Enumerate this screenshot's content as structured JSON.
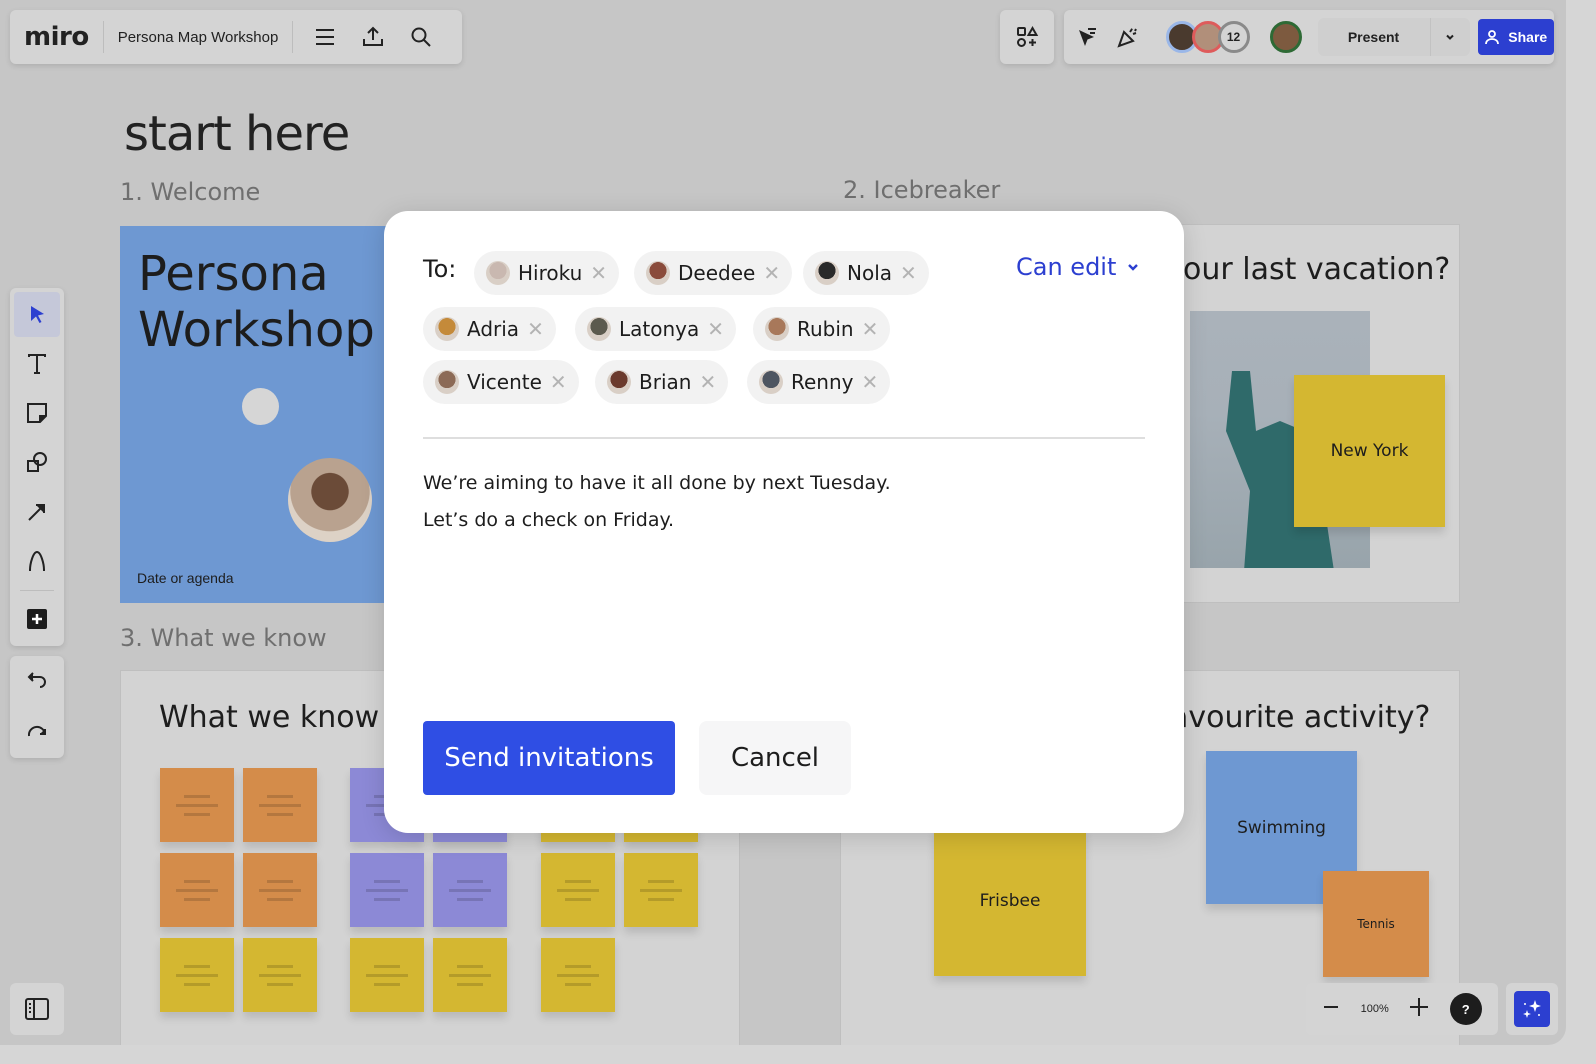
{
  "app": {
    "logo": "miro",
    "board_title": "Persona Map Workshop"
  },
  "topbar": {
    "icons": [
      "menu-icon",
      "export-icon",
      "search-icon"
    ],
    "apps_icon": "shapes-apps-icon",
    "right_icons": [
      "cursor-filter-icon",
      "celebration-icon"
    ],
    "collaborator_count": "12",
    "present_label": "Present",
    "share_label": "Share",
    "share_color": "#2c3fd0"
  },
  "left_toolbar": {
    "tools": [
      {
        "name": "select",
        "icon": "cursor-icon",
        "active": true
      },
      {
        "name": "text",
        "icon": "text-icon",
        "active": false
      },
      {
        "name": "sticky-note",
        "icon": "sticky-note-icon",
        "active": false
      },
      {
        "name": "shapes",
        "icon": "shapes-icon",
        "active": false
      },
      {
        "name": "connector",
        "icon": "arrow-icon",
        "active": false
      },
      {
        "name": "pen",
        "icon": "pen-icon",
        "active": false
      },
      {
        "name": "more",
        "icon": "plus-icon",
        "active": false
      }
    ],
    "undo_icon": "undo-icon",
    "redo_icon": "redo-icon"
  },
  "canvas": {
    "heading": "start here",
    "sections": [
      {
        "label": "1. Welcome"
      },
      {
        "label": "2. Icebreaker"
      },
      {
        "label": "3. What we know"
      }
    ],
    "welcome_card": {
      "title_line1": "Persona",
      "title_line2": "Workshop",
      "subtitle": "Date or agenda"
    },
    "icebreaker_top_title": "our last vacation?",
    "icebreaker_top_sticky": "New York",
    "icebreaker_bottom_title": "avourite activity?",
    "icebreaker_bottom_stickies": [
      "Frisbee",
      "Swimming",
      "Tennis"
    ],
    "what_we_know_title": "What we know a"
  },
  "zoom_controls": {
    "zoom_level": "100%",
    "help_label": "?"
  },
  "dialog": {
    "to_label": "To:",
    "recipients": [
      {
        "name": "Hiroku",
        "avatar_color": "#c9b8b0"
      },
      {
        "name": "Deedee",
        "avatar_color": "#8a4b3b"
      },
      {
        "name": "Nola",
        "avatar_color": "#2a2a2a"
      },
      {
        "name": "Adria",
        "avatar_color": "#c48a3a"
      },
      {
        "name": "Latonya",
        "avatar_color": "#5c5a4e"
      },
      {
        "name": "Rubin",
        "avatar_color": "#a8785a"
      },
      {
        "name": "Vicente",
        "avatar_color": "#8c6a56"
      },
      {
        "name": "Brian",
        "avatar_color": "#6b3a2c"
      },
      {
        "name": "Renny",
        "avatar_color": "#4e5560"
      }
    ],
    "permission": "Can edit",
    "message_line1": "We’re aiming to have it all done by next Tuesday.",
    "message_line2": "Let’s do a check on Friday.",
    "send_label": "Send invitations",
    "cancel_label": "Cancel",
    "primary_color": "#2f4ee4"
  }
}
